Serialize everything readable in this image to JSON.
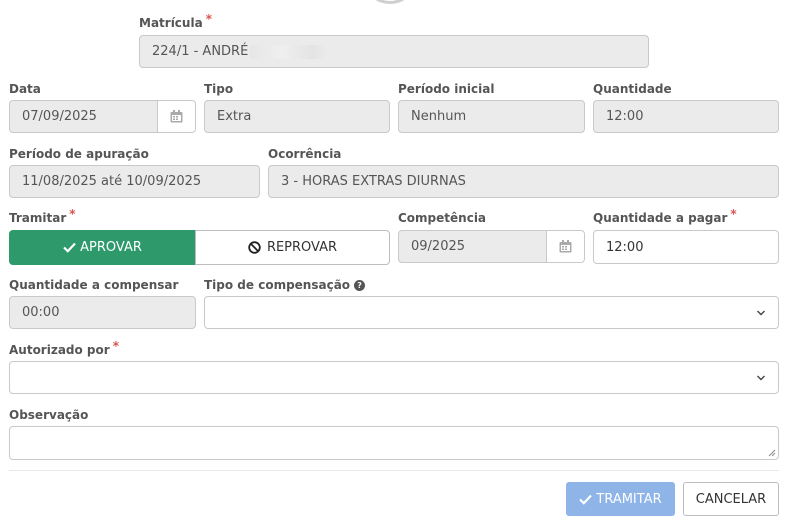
{
  "form": {
    "matricula": {
      "label": "Matrícula",
      "value": "224/1 - ANDRÉ"
    },
    "data": {
      "label": "Data",
      "value": "07/09/2025"
    },
    "tipo": {
      "label": "Tipo",
      "value": "Extra"
    },
    "periodo_inicial": {
      "label": "Período inicial",
      "value": "Nenhum"
    },
    "quantidade": {
      "label": "Quantidade",
      "value": "12:00"
    },
    "periodo_apuracao": {
      "label": "Período de apuração",
      "value": "11/08/2025 até 10/09/2025"
    },
    "ocorrencia": {
      "label": "Ocorrência",
      "value": "3 - HORAS EXTRAS DIURNAS"
    },
    "tramitar": {
      "label": "Tramitar",
      "approve_label": "APROVAR",
      "reject_label": "REPROVAR"
    },
    "competencia": {
      "label": "Competência",
      "value": "09/2025"
    },
    "quantidade_pagar": {
      "label": "Quantidade a pagar",
      "value": "12:00"
    },
    "quantidade_compensar": {
      "label": "Quantidade a compensar",
      "value": "00:00"
    },
    "tipo_compensacao": {
      "label": "Tipo de compensação",
      "value": ""
    },
    "autorizado_por": {
      "label": "Autorizado por",
      "value": ""
    },
    "observacao": {
      "label": "Observação",
      "value": ""
    },
    "required_mark": "*"
  },
  "footer": {
    "submit_label": "TRAMITAR",
    "cancel_label": "CANCELAR"
  },
  "colors": {
    "approve": "#2e9a6c",
    "submit": "#8fb4e8",
    "required": "#d9534f"
  },
  "icons": [
    "calendar-icon",
    "check-icon",
    "ban-icon",
    "chevron-down-icon",
    "question-circle-icon",
    "resize-handle-icon"
  ]
}
